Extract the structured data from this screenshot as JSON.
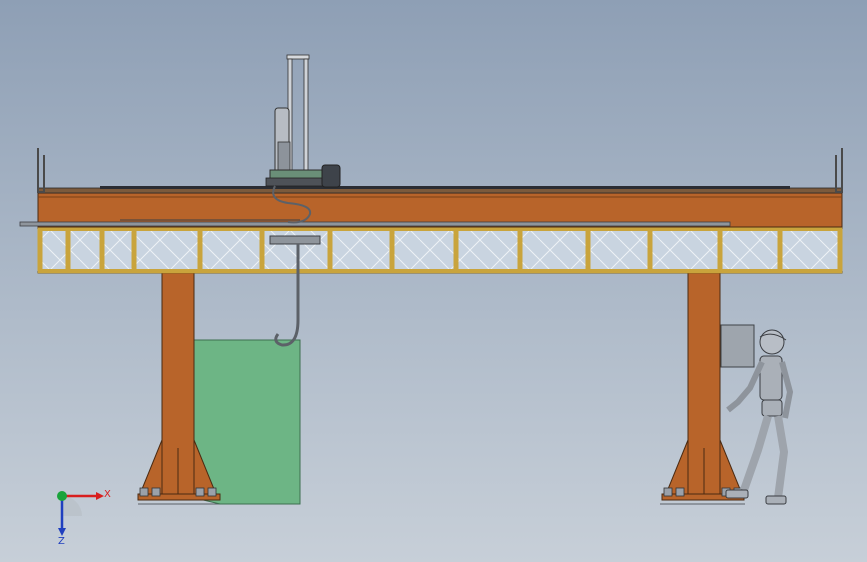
{
  "triad": {
    "x_label": "X",
    "y_label": "Z"
  },
  "colors": {
    "beam_orange": "#b8642a",
    "truss_frame": "#c9a43c",
    "glass_fill": "#c9d4e0",
    "tank_green": "#6db585",
    "steel_grey": "#9aa1aa",
    "axis_x": "#d81e1e",
    "axis_y": "#19a33b",
    "axis_z": "#1f3fbf"
  },
  "icons": [
    "axis-triad-icon",
    "human-figure-icon"
  ]
}
